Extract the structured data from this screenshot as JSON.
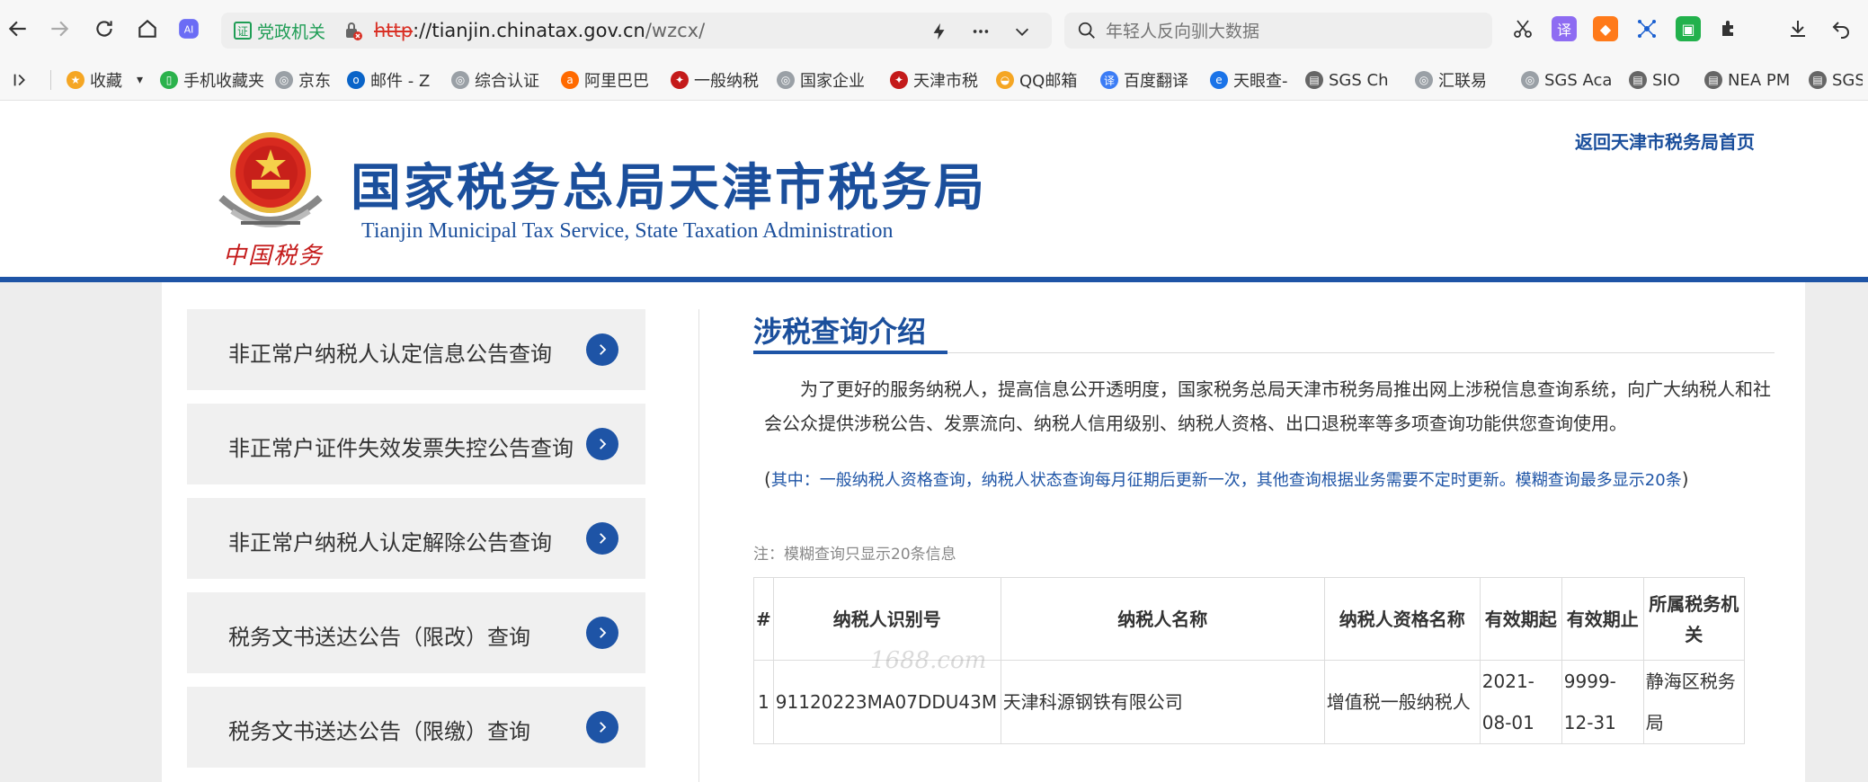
{
  "browser": {
    "cert_label": "党政机关",
    "url_protocol": "http",
    "url_host": "://tianjin.chinatax.gov.cn",
    "url_path": "/wzcx/",
    "search_placeholder": "年轻人反向驯大数据",
    "bookmarks": [
      {
        "label": "收藏",
        "icon": "star-icon",
        "color": "#f5a623"
      },
      {
        "label": "手机收藏夹",
        "icon": "phone-icon",
        "color": "#2bb24c"
      },
      {
        "label": "京东",
        "icon": "globe-icon",
        "color": "#9aa0a6"
      },
      {
        "label": "邮件 - Z",
        "icon": "outlook-icon",
        "color": "#0a64c8"
      },
      {
        "label": "综合认证",
        "icon": "globe-icon",
        "color": "#9aa0a6"
      },
      {
        "label": "阿里巴巴",
        "icon": "alibaba-icon",
        "color": "#ff6a00"
      },
      {
        "label": "一般纳税",
        "icon": "tax-emblem-icon",
        "color": "#c41a1a"
      },
      {
        "label": "国家企业",
        "icon": "globe-icon",
        "color": "#9aa0a6"
      },
      {
        "label": "天津市税",
        "icon": "tax-emblem-icon",
        "color": "#c41a1a"
      },
      {
        "label": "QQ邮箱",
        "icon": "qq-mail-icon",
        "color": "#f5a623"
      },
      {
        "label": "百度翻译",
        "icon": "translate-icon",
        "color": "#3b7cf5"
      },
      {
        "label": "天眼查-",
        "icon": "tianyancha-icon",
        "color": "#1a73e8"
      },
      {
        "label": "SGS Ch",
        "icon": "page-icon",
        "color": "#666666"
      },
      {
        "label": "汇联易",
        "icon": "globe-icon",
        "color": "#9aa0a6"
      },
      {
        "label": "SGS Aca",
        "icon": "globe-icon",
        "color": "#9aa0a6"
      },
      {
        "label": "SIO",
        "icon": "page-icon",
        "color": "#666666"
      },
      {
        "label": "NEA PM",
        "icon": "page-icon",
        "color": "#666666"
      },
      {
        "label": "SGS",
        "icon": "page-icon",
        "color": "#666666"
      }
    ]
  },
  "header": {
    "title": "国家税务总局天津市税务局",
    "subtitle": "Tianjin Municipal Tax Service, State Taxation Administration",
    "seal_text": "中国税务",
    "home_link": "返回天津市税务局首页"
  },
  "sidebar": {
    "items": [
      {
        "label": "非正常户纳税人认定信息公告查询"
      },
      {
        "label": "非正常户证件失效发票失控公告查询"
      },
      {
        "label": "非正常户纳税人认定解除公告查询"
      },
      {
        "label": "税务文书送达公告（限改）查询"
      },
      {
        "label": "税务文书送达公告（限缴）查询"
      }
    ]
  },
  "main": {
    "section_title": "涉税查询介绍",
    "intro": "为了更好的服务纳税人，提高信息公开透明度，国家税务总局天津市税务局推出网上涉税信息查询系统，向广大纳税人和社会公众提供涉税公告、发票流向、纳税人信用级别、纳税人资格、出口退税率等多项查询功能供您查询使用。",
    "note_open": "(",
    "note": "其中：一般纳税人资格查询，纳税人状态查询每月征期后更新一次，其他查询根据业务需要不定时更新。模糊查询最多显示20条",
    "note_close": ")",
    "fuzzy_note": "注：模糊查询只显示20条信息",
    "watermark": "1688.com",
    "table": {
      "headers": [
        "#",
        "纳税人识别号",
        "纳税人名称",
        "纳税人资格名称",
        "有效期起",
        "有效期止",
        "所属税务机关"
      ],
      "rows": [
        [
          "1",
          "91120223MA07DDU43M",
          "天津科源钢铁有限公司",
          "增值税一般纳税人",
          "2021-08-01",
          "9999-12-31",
          "静海区税务局"
        ]
      ]
    }
  }
}
